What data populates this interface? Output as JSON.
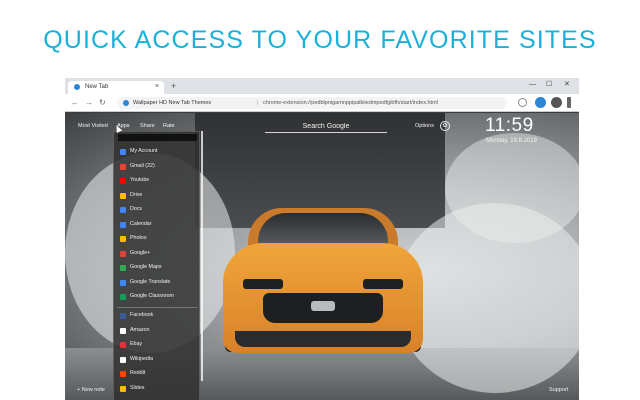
{
  "headline": "QUICK ACCESS TO YOUR FAVORITE SITES",
  "browser": {
    "tab_title": "New Tab",
    "tab_close": "×",
    "new_tab": "+",
    "site_name": "Wallpaper HD New Tab Themes",
    "url_separator": "|",
    "url": "chrome-extension://pedblpnigamnppipalkiiedmpedfgibfh/start/index.html",
    "minimize": "—",
    "maximize": "☐",
    "close": "✕",
    "back": "←",
    "forward": "→",
    "reload": "↻"
  },
  "newtab": {
    "nav": {
      "most_visited": "Most Visited",
      "apps": "Apps",
      "share": "Share",
      "rate": "Rate"
    },
    "search_placeholder": "Search Google",
    "options_label": "Options",
    "options_icon": "✿",
    "clock": "11:59",
    "date": "Monday, 19.8.2019",
    "footer_left": "+ New note",
    "footer_right": "Support"
  },
  "apps_menu": {
    "google_items": [
      {
        "label": "My Account",
        "icon": "account-icon",
        "color": "#4285f4"
      },
      {
        "label": "Gmail (22)",
        "icon": "gmail-icon",
        "color": "#ea4335"
      },
      {
        "label": "Youtube",
        "icon": "youtube-icon",
        "color": "#ff0000"
      },
      {
        "label": "Drive",
        "icon": "drive-icon",
        "color": "#fbbc04"
      },
      {
        "label": "Docs",
        "icon": "docs-icon",
        "color": "#4285f4"
      },
      {
        "label": "Calendar",
        "icon": "calendar-icon",
        "color": "#4285f4"
      },
      {
        "label": "Photos",
        "icon": "photos-icon",
        "color": "#fbbc04"
      },
      {
        "label": "Google+",
        "icon": "google-plus-icon",
        "color": "#db4437"
      },
      {
        "label": "Google Maps",
        "icon": "maps-icon",
        "color": "#34a853"
      },
      {
        "label": "Google Translate",
        "icon": "translate-icon",
        "color": "#4285f4"
      },
      {
        "label": "Google Classroom",
        "icon": "classroom-icon",
        "color": "#0f9d58"
      }
    ],
    "other_items": [
      {
        "label": "Facebook",
        "icon": "facebook-icon",
        "color": "#3b5998"
      },
      {
        "label": "Amazon",
        "icon": "amazon-icon",
        "color": "#ffffff"
      },
      {
        "label": "Ebay",
        "icon": "ebay-icon",
        "color": "#e53238"
      },
      {
        "label": "Wikipedia",
        "icon": "wikipedia-icon",
        "color": "#ffffff"
      },
      {
        "label": "Reddit",
        "icon": "reddit-icon",
        "color": "#ff4500"
      },
      {
        "label": "Slides",
        "icon": "slides-icon",
        "color": "#fbbc04"
      }
    ]
  },
  "colors": {
    "headline": "#1ab0d8",
    "car": "#e8932f"
  }
}
